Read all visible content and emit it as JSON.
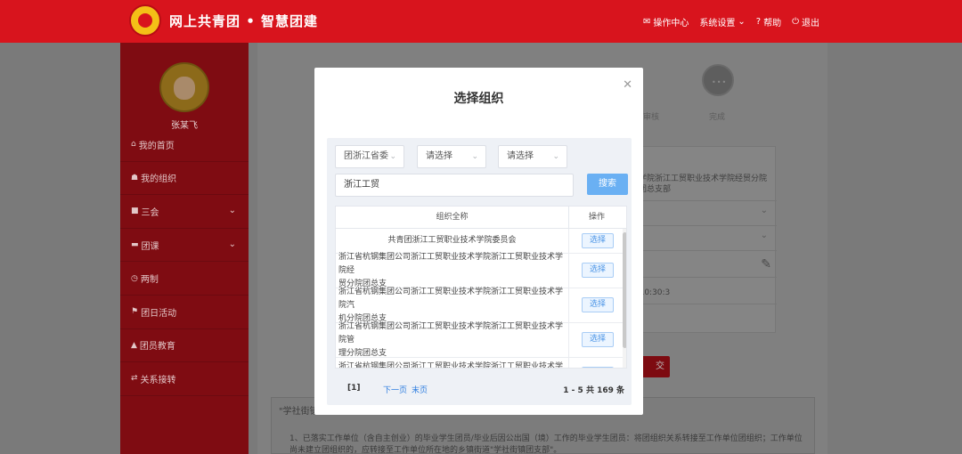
{
  "header": {
    "brand": "网上共青团 • 智慧团建",
    "nav": [
      {
        "label": "操作中心",
        "icon": "envelope-icon"
      },
      {
        "label": "系统设置",
        "icon": "chevron-down-icon"
      },
      {
        "label": "帮助",
        "icon": "question-circle-icon"
      },
      {
        "label": "退出",
        "icon": "power-icon"
      }
    ]
  },
  "sidebar": {
    "username": "张某飞",
    "items": [
      {
        "label": "我的首页",
        "icon": "home-icon"
      },
      {
        "label": "我的组织",
        "icon": "group-icon"
      },
      {
        "label": "三会",
        "icon": "square-icon",
        "expandable": true
      },
      {
        "label": "团课",
        "icon": "folder-icon",
        "expandable": true
      },
      {
        "label": "两制",
        "icon": "clock-icon"
      },
      {
        "label": "团日活动",
        "icon": "flag-icon"
      },
      {
        "label": "团员教育",
        "icon": "graduation-icon"
      },
      {
        "label": "关系接转",
        "icon": "transfer-icon"
      }
    ]
  },
  "background": {
    "step_label": "完成",
    "step_prev_label": "审核",
    "org_text": "学院浙江工贸职业技术学院经贸分院团总支部",
    "date_text": "0 10:30:3",
    "submit_label": "交",
    "notice_title": "\"学社街镇",
    "notice_body": "1、已落实工作单位（含自主创业）的毕业学生团员/毕业后因公出国（境）工作的毕业学生团员：将团组织关系转接至工作单位团组织；工作单位尚未建立团组织的，应转接至工作单位所在地的乡镇街道\"学社街镇团支部\"。"
  },
  "modal": {
    "title": "选择组织",
    "filters": [
      "团浙江省委",
      "请选择",
      "请选择"
    ],
    "search_value": "浙江工贸",
    "search_button": "搜索",
    "table": {
      "col_name": "组织全称",
      "col_op": "操作",
      "rows": [
        {
          "name": [
            "共青团浙江工贸职业技术学院委员会"
          ],
          "action": "选择"
        },
        {
          "name": [
            "浙江省杭钢集团公司浙江工贸职业技术学院浙江工贸职业技术学院经",
            "贸分院团总支"
          ],
          "action": "选择"
        },
        {
          "name": [
            "浙江省杭钢集团公司浙江工贸职业技术学院浙江工贸职业技术学院汽",
            "机分院团总支"
          ],
          "action": "选择"
        },
        {
          "name": [
            "浙江省杭钢集团公司浙江工贸职业技术学院浙江工贸职业技术学院管",
            "理分院团总支"
          ],
          "action": "选择"
        },
        {
          "name": [
            "浙江省杭钢集团公司浙江工贸职业技术学院浙江工贸职业技术学院"
          ],
          "action": "选择"
        }
      ]
    },
    "pager": {
      "current": "[1]",
      "next": "下一页",
      "last": "末页",
      "total": "1 - 5  共 169 条"
    }
  }
}
